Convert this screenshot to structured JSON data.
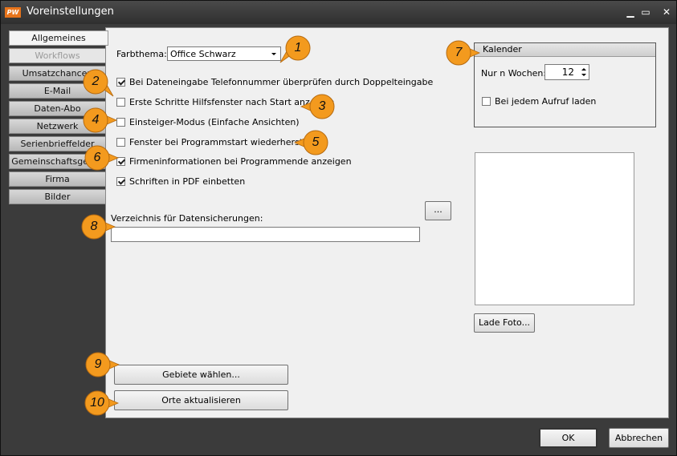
{
  "window": {
    "title": "Voreinstellungen",
    "logo_text": "PW",
    "minimize": "▁",
    "maximize": "▭",
    "close": "✕"
  },
  "tabs": [
    {
      "label": "Allgemeines",
      "state": "active"
    },
    {
      "label": "Workflows",
      "state": "disabled"
    },
    {
      "label": "Umsatzchancen",
      "state": "normal"
    },
    {
      "label": "E-Mail",
      "state": "normal"
    },
    {
      "label": "Daten-Abo",
      "state": "normal"
    },
    {
      "label": "Netzwerk",
      "state": "normal"
    },
    {
      "label": "Serienbrieffelder",
      "state": "normal"
    },
    {
      "label": "Gemeinschaftsgesch",
      "state": "normal"
    },
    {
      "label": "Firma",
      "state": "normal"
    },
    {
      "label": "Bilder",
      "state": "normal"
    }
  ],
  "general": {
    "color_theme_label": "Farbthema:",
    "color_theme_value": "Office Schwarz",
    "checkboxes": [
      {
        "label": "Bei Dateneingabe Telefonnummer überprüfen durch Doppelteingabe",
        "checked": true
      },
      {
        "label": "Erste Schritte Hilfsfenster nach Start anzeigen",
        "checked": false
      },
      {
        "label": "Einsteiger-Modus (Einfache Ansichten)",
        "checked": false
      },
      {
        "label": "Fenster bei Programmstart wiederherstellen",
        "checked": false
      },
      {
        "label": "Firmeninformationen bei Programmende anzeigen",
        "checked": true
      },
      {
        "label": "Schriften in PDF einbetten",
        "checked": true
      }
    ],
    "browse_button": "...",
    "backup_dir_label": "Verzeichnis für Datensicherungen:",
    "backup_dir_value": "",
    "select_areas_button": "Gebiete wählen...",
    "update_places_button": "Orte aktualisieren"
  },
  "calendar": {
    "title": "Kalender",
    "weeks_label": "Nur n Wochen:",
    "weeks_value": "12",
    "reload_label": "Bei jedem Aufruf laden",
    "reload_checked": false
  },
  "photo": {
    "load_button": "Lade Foto..."
  },
  "footer": {
    "ok": "OK",
    "cancel": "Abbrechen"
  },
  "callouts": [
    "1",
    "2",
    "3",
    "4",
    "5",
    "6",
    "7",
    "8",
    "9",
    "10"
  ],
  "colors": {
    "callout": "#f39a1e",
    "callout_shadow": "#b56a10"
  }
}
